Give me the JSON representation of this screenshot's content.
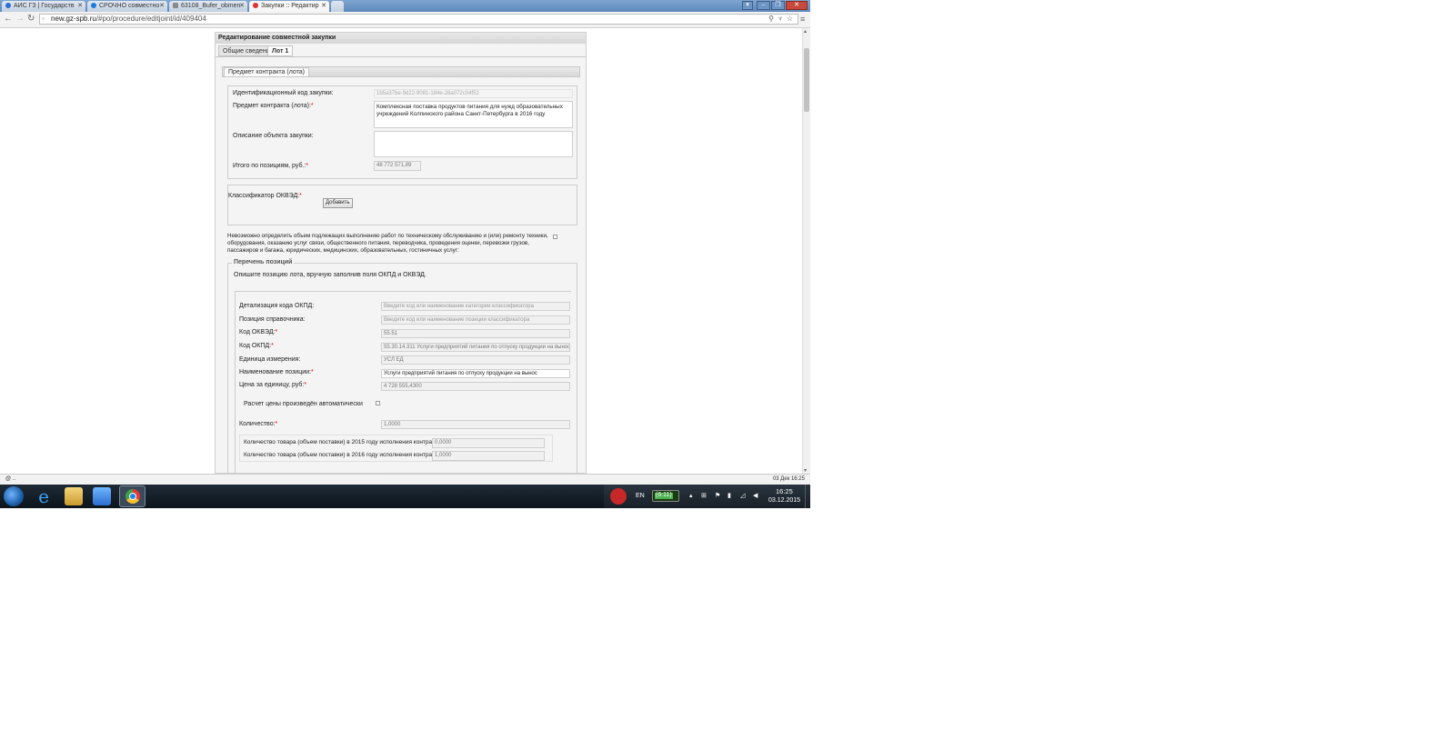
{
  "browser": {
    "tabs": [
      {
        "title": "АИС ГЗ | Государств",
        "active": false
      },
      {
        "title": "СРОЧНО совместно",
        "active": false
      },
      {
        "title": "63108_Bufer_obmen",
        "active": false
      },
      {
        "title": "Закупки :: Редактир",
        "active": true
      }
    ],
    "url_host": "new.gz-spb.ru",
    "url_path": "/#po/procedure/editjoint/id/409404",
    "status_left": "@ ..",
    "status_right": "03 Дек 16:25"
  },
  "page": {
    "title": "Редактирование совместной закупки",
    "tabs": [
      "Общие сведения",
      "Лот 1"
    ],
    "subtab": "Предмет контракта (лота)",
    "identification_code_label": "Идентификационный код закупки:",
    "identification_code_value": "1b5a37be-9d22-9081-184e-28a072c04f52",
    "contract_subject_label": "Предмет контракта (лота):",
    "contract_subject_value": "Комплексная поставка продуктов питания для нужд образовательных учреждений Колпинского района Санкт-Петербурга в 2016 году",
    "object_description_label": "Описание объекта закупки:",
    "total_label": "Итого по позициям, руб.:",
    "total_value": "48 772 571,89",
    "okved_label": "Классификатор ОКВЭД:",
    "add_button": "Добавить",
    "impossible_text": "Невозможно определить объем подлежащих выполнению работ по техническому обслуживанию и (или) ремонту техники, оборудования, оказанию услуг связи, общественного питания, переводчика, проведения оценки, перевозки грузов, пассажиров и багажа, юридических, медицинских, образовательных, гостиничных услуг:",
    "positions_legend": "Перечень позиций",
    "positions_hint": "Опишите позицию лота, вручную заполнив поля ОКПД и ОКВЭД.",
    "okpd_detail_label": "Детализация кода ОКПД:",
    "okpd_detail_placeholder": "Введите код или наименование категории классификатора",
    "ref_position_label": "Позиция справочника:",
    "ref_position_placeholder": "Введите код или наименование позиции классификатора",
    "okved_code_label": "Код ОКВЭД:",
    "okved_code_value": "55.51",
    "okpd_code_label": "Код ОКПД:",
    "okpd_code_value": "55.30.14.311 Услуги предприятий питания по отпуску продукции на вынос",
    "unit_label": "Единица измерения:",
    "unit_value": "УСЛ ЕД",
    "position_name_label": "Наименование позиции:",
    "position_name_value": "Услуги предприятий питания по отпуску продукции на вынос",
    "unit_price_label": "Цена за единицу, руб:",
    "unit_price_value": "4 728 555,4300",
    "auto_price_label": "Расчет цены произведён автоматически",
    "quantity_label": "Количество:",
    "quantity_value": "1,0000",
    "qty_2015_label": "Количество товара (объем поставки) в 2015 году исполнения контракта:",
    "qty_2015_value": "0,0000",
    "qty_2016_label": "Количество товара (объем поставки) в 2016 году исполнения контракта:",
    "qty_2016_value": "1,0000"
  },
  "taskbar": {
    "lang": "EN",
    "battery": "(6:11)",
    "time": "16:25",
    "date": "03.12.2015"
  },
  "colors": {
    "taskbar": "#0c141c",
    "tabbar": "#5c87bb",
    "required": "#dd0000"
  }
}
